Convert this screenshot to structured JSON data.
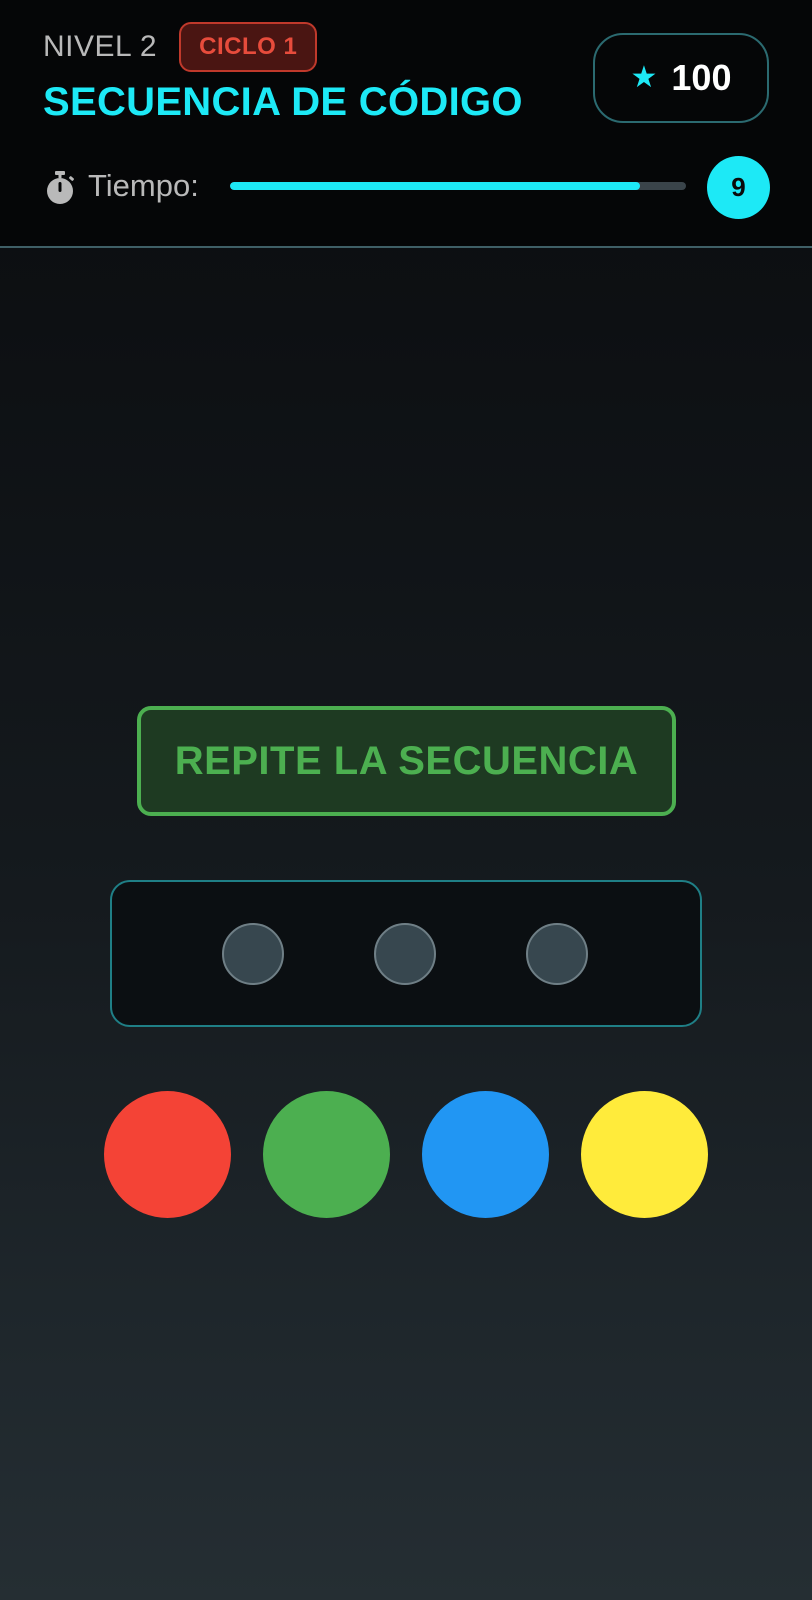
{
  "header": {
    "level_label": "NIVEL 2",
    "cycle_badge": "CICLO 1",
    "title": "SECUENCIA DE CÓDIGO",
    "score": "100",
    "score_icon": "star-icon"
  },
  "timer": {
    "label": "Tiempo:",
    "icon": "stopwatch-icon",
    "remaining_seconds": "9",
    "progress_fraction": 0.9
  },
  "instruction": "REPITE LA SECUENCIA",
  "sequence": {
    "slots_total": 3,
    "slots_filled": 0
  },
  "color_buttons": [
    {
      "name": "red",
      "color": "#f44336"
    },
    {
      "name": "green",
      "color": "#4caf50"
    },
    {
      "name": "blue",
      "color": "#2196f3"
    },
    {
      "name": "yellow",
      "color": "#ffeb3b"
    }
  ],
  "colors": {
    "accent": "#1de9f6",
    "badge_red": "#e74c3c",
    "instruction_green": "#4caf50"
  }
}
